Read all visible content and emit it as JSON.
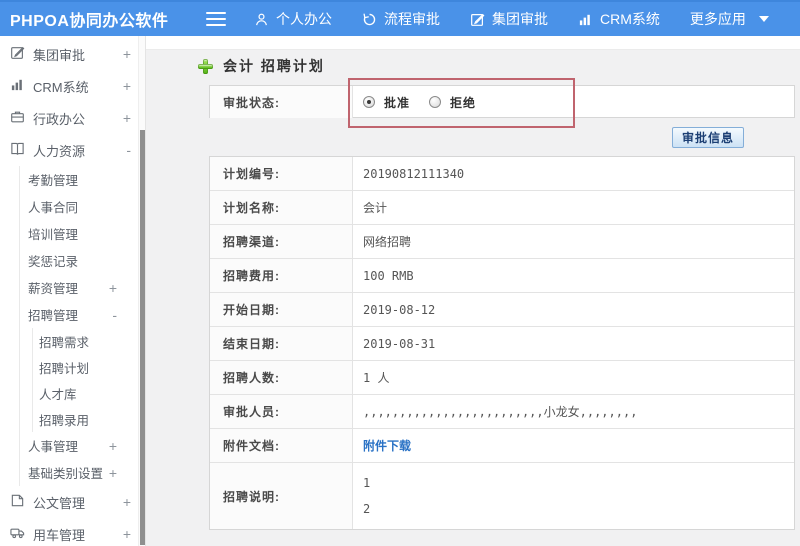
{
  "topbar": {
    "title": "PHPOA协同办公软件",
    "items": [
      {
        "label": "个人办公",
        "icon": "person-icon"
      },
      {
        "label": "流程审批",
        "icon": "history-icon"
      },
      {
        "label": "集团审批",
        "icon": "edit-icon"
      },
      {
        "label": "CRM系统",
        "icon": "bar-chart-icon"
      },
      {
        "label": "更多应用",
        "icon": "caret-down-icon"
      }
    ]
  },
  "sidebar": {
    "groups": [
      {
        "label": "集团审批",
        "toggle": "+",
        "icon": "edit-icon"
      },
      {
        "label": "CRM系统",
        "toggle": "+",
        "icon": "bar-chart-icon"
      },
      {
        "label": "行政办公",
        "toggle": "+",
        "icon": "briefcase-icon"
      },
      {
        "label": "人力资源",
        "toggle": "-",
        "icon": "book-icon",
        "children": [
          {
            "label": "考勤管理"
          },
          {
            "label": "人事合同"
          },
          {
            "label": "培训管理"
          },
          {
            "label": "奖惩记录"
          },
          {
            "label": "薪资管理",
            "toggle": "+"
          },
          {
            "label": "招聘管理",
            "toggle": "-",
            "children": [
              {
                "label": "招聘需求"
              },
              {
                "label": "招聘计划"
              },
              {
                "label": "人才库"
              },
              {
                "label": "招聘录用"
              }
            ]
          },
          {
            "label": "人事管理",
            "toggle": "+"
          },
          {
            "label": "基础类别设置",
            "toggle": "+"
          }
        ]
      },
      {
        "label": "公文管理",
        "toggle": "+",
        "icon": "document-icon"
      },
      {
        "label": "用车管理",
        "toggle": "+",
        "icon": "truck-icon"
      }
    ]
  },
  "main": {
    "page_title": "会计 招聘计划",
    "status_row": {
      "label": "审批状态:",
      "approve_label": "批准",
      "reject_label": "拒绝",
      "approve_checked": true,
      "reject_checked": false
    },
    "approve_info_button": "审批信息",
    "rows": [
      {
        "label": "计划编号:",
        "value": "20190812111340"
      },
      {
        "label": "计划名称:",
        "value": "会计"
      },
      {
        "label": "招聘渠道:",
        "value": "网络招聘"
      },
      {
        "label": "招聘费用:",
        "value": "100 RMB"
      },
      {
        "label": "开始日期:",
        "value": "2019-08-12"
      },
      {
        "label": "结束日期:",
        "value": "2019-08-31"
      },
      {
        "label": "招聘人数:",
        "value": "1 人"
      },
      {
        "label": "审批人员:",
        "value": ",,,,,,,,,,,,,,,,,,,,,,,,,小龙女,,,,,,,,"
      },
      {
        "label": "附件文档:",
        "value": "附件下载"
      },
      {
        "label": "招聘说明:",
        "value_line1": "1",
        "value_line2": "2"
      }
    ]
  },
  "colors": {
    "topbar_blue": "#4a92e8",
    "highlight_red": "#c0646e",
    "link_blue": "#2a72c5",
    "plus_green": "#54b416",
    "button_border_blue": "#84aed8"
  }
}
